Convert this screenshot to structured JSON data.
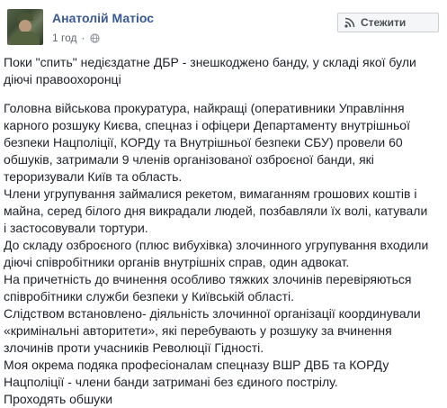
{
  "author": {
    "name": "Анатолій Матіос"
  },
  "meta": {
    "time": "1 год",
    "separator": "·",
    "privacy_icon": "globe-icon"
  },
  "follow_button": {
    "icon": "rss-icon",
    "label": "Стежити"
  },
  "post": {
    "intro": [
      "Поки \"спить\" недієздатне ДБР - знешкоджено банду, у складі якої були",
      "діючі правоохоронці"
    ],
    "lines": [
      "Головна військова прокуратура, найкращі (оперативники Управління",
      "карного розшуку Києва, спецназ і офіцери Департаменту внутрішньої",
      "безпеки Нацполіції, КОРДу та Внутрішньої безпеки СБУ) провели 60",
      "обшуків, затримали 9 членів організованої озброєної банди, які",
      "тероризували Київ та область.",
      "Члени угрупування займалися рекетом, вимаганням грошових коштів і",
      "майна, серед білого дня викрадали людей, позбавляли їх волі, катували",
      "і застосовували тортури.",
      "До складу озброєного (плюс вибухівка) злочинного угрупування входили",
      "діючі співробітники органів внутрішніх справ, один адвокат.",
      "На причетність до вчинення особливо тяжких злочинів перевіряються",
      "співробітники служби безпеки у Київській області.",
      "Слідством встановлено- діяльність злочинної організації координували",
      "«кримінальні авторитети», які перебувають у розшуку за вчинення",
      "злочинів проти учасників Революції Гідності.",
      "Моя окрема подяка професіоналам спецназу ВШР ДВБ та КОРДу",
      "Нацполіції - члени банди затримані без єдиного пострілу.",
      "Проходять обшуки"
    ]
  },
  "colors": {
    "author_link": "#385898",
    "text": "#1d2129",
    "meta": "#616770",
    "button_bg": "#f5f6f7",
    "button_border": "#ccd0d5"
  }
}
